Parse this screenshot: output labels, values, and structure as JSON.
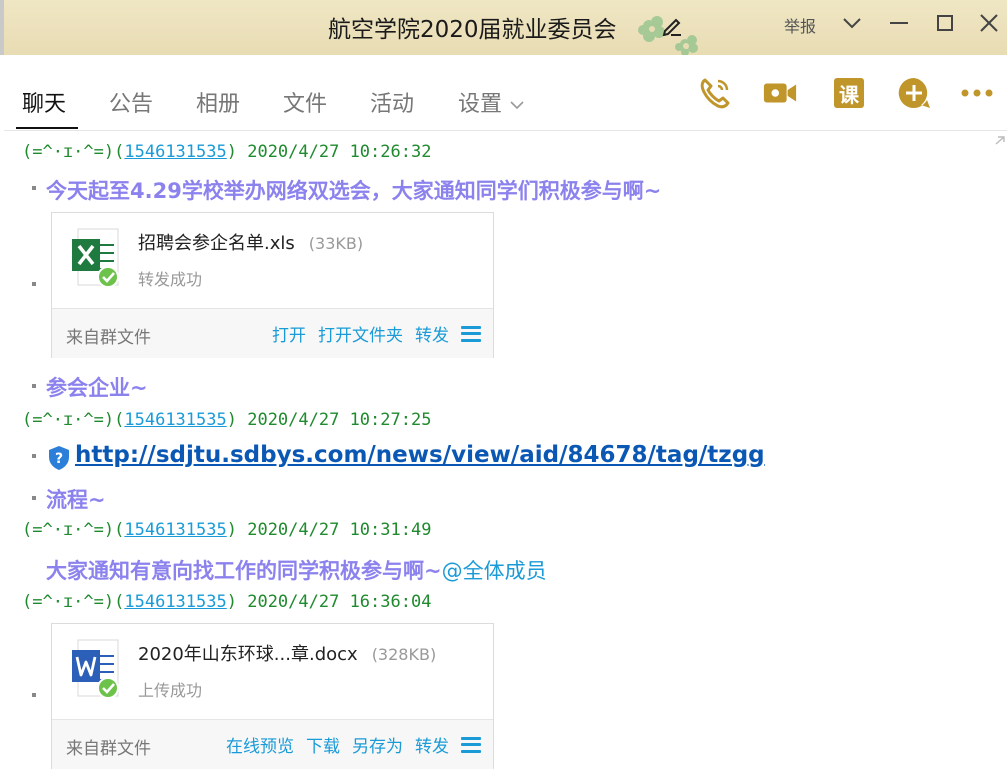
{
  "window": {
    "title": "航空学院2020届就业委员会",
    "report_label": "举报"
  },
  "tabs": [
    {
      "label": "聊天",
      "active": true
    },
    {
      "label": "公告"
    },
    {
      "label": "相册"
    },
    {
      "label": "文件"
    },
    {
      "label": "活动"
    },
    {
      "label": "设置"
    }
  ],
  "toolbar": {
    "course_label": "课",
    "icons": [
      "phone-icon",
      "video-icon",
      "course-icon",
      "add-icon",
      "more-icon"
    ]
  },
  "messages": [
    {
      "sender": "(=^·ɪ·^=)",
      "qq": "1546131535",
      "time": "2020/4/27 10:26:32"
    },
    {
      "sender": "(=^·ɪ·^=)",
      "qq": "1546131535",
      "time": "2020/4/27 10:27:25"
    },
    {
      "sender": "(=^·ɪ·^=)",
      "qq": "1546131535",
      "time": "2020/4/27 10:31:49"
    },
    {
      "sender": "(=^·ɪ·^=)",
      "qq": "1546131535",
      "time": "2020/4/27 16:36:04"
    }
  ],
  "texts": {
    "line1": "今天起至4.29学校举办网络双选会，大家通知同学们积极参与啊~",
    "line2": "参会企业~",
    "link": "http://sdjtu.sdbys.com/news/view/aid/84678/tag/tzgg",
    "line3": "流程~",
    "line4": "大家通知有意向找工作的同学积极参与啊~",
    "mention": "@全体成员"
  },
  "files": [
    {
      "name": "招聘会参企名单.xls",
      "size": "(33KB)",
      "status": "转发成功",
      "source": "来自群文件",
      "actions": [
        "打开",
        "打开文件夹",
        "转发"
      ]
    },
    {
      "name": "2020年山东环球...章.docx",
      "size": "(328KB)",
      "status": "上传成功",
      "source": "来自群文件",
      "actions": [
        "在线预览",
        "下载",
        "另存为",
        "转发"
      ]
    }
  ],
  "colors": {
    "accent": "#1a9bd7",
    "message_purple": "#8c82ee",
    "meta_green": "#1f8a2e",
    "toolbar_gold": "#c0952a",
    "excel_green": "#1f7a3f",
    "word_blue": "#2b5fb8",
    "success_green": "#6cc24a"
  }
}
